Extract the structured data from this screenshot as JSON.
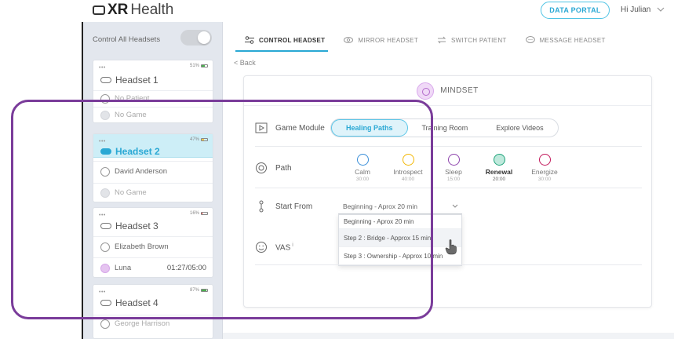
{
  "header": {
    "brand_bold": "XR",
    "brand_light": "Health",
    "portal_button": "DATA PORTAL",
    "greeting": "Hi Julian"
  },
  "sidebar": {
    "control_all_label": "Control All Headsets",
    "control_all_on": false,
    "headsets": [
      {
        "name": "Headset 1",
        "battery": "51%",
        "battery_level": 0.51,
        "battery_color": "#4caf50",
        "patient": "No Patient",
        "game": "No Game",
        "timer": "",
        "active": false
      },
      {
        "name": "Headset 2",
        "battery": "47%",
        "battery_level": 0.47,
        "battery_color": "#f2c94c",
        "patient": "David Anderson",
        "game": "No Game",
        "timer": "",
        "active": true
      },
      {
        "name": "Headset 3",
        "battery": "16%",
        "battery_level": 0.16,
        "battery_color": "#e53935",
        "patient": "Elizabeth Brown",
        "game": "Luna",
        "timer": "01:27/05:00",
        "active": false
      },
      {
        "name": "Headset 4",
        "battery": "87%",
        "battery_level": 0.87,
        "battery_color": "#4caf50",
        "patient": "George Harrison",
        "game": "",
        "timer": "",
        "active": false
      }
    ]
  },
  "tabs": [
    {
      "label": "CONTROL HEADSET",
      "icon": "sliders-icon",
      "active": true
    },
    {
      "label": "MIRROR HEADSET",
      "icon": "eye-icon",
      "active": false
    },
    {
      "label": "SWITCH PATIENT",
      "icon": "swap-arrows-icon",
      "active": false
    },
    {
      "label": "MESSAGE HEADSET",
      "icon": "chat-bubble-icon",
      "active": false
    }
  ],
  "back_label": "< Back",
  "panel": {
    "title": "MINDSET",
    "game_module": {
      "label": "Game Module",
      "options": [
        "Healing Paths",
        "Training Room",
        "Explore Videos"
      ],
      "selected": "Healing Paths"
    },
    "path": {
      "label": "Path",
      "options": [
        {
          "name": "Calm",
          "duration": "30:00",
          "color": "#3a8fd9",
          "fill": "transparent",
          "selected": false
        },
        {
          "name": "Introspect",
          "duration": "40:00",
          "color": "#f2b705",
          "fill": "transparent",
          "selected": false
        },
        {
          "name": "Sleep",
          "duration": "15:00",
          "color": "#8e44ad",
          "fill": "transparent",
          "selected": false
        },
        {
          "name": "Renewal",
          "duration": "20:00",
          "color": "#1fa37a",
          "fill": "#bfe9dc",
          "selected": true
        },
        {
          "name": "Energize",
          "duration": "30:00",
          "color": "#c2185b",
          "fill": "transparent",
          "selected": false
        }
      ]
    },
    "start_from": {
      "label": "Start From",
      "value": "Beginning - Aprox 20 min",
      "options": [
        "Beginning - Aprox 20 min",
        "Step 2 : Bridge - Approx 15 min",
        "Step 3 : Ownership - Approx 10 min"
      ],
      "highlighted": "Step 2 : Bridge - Approx 15 min"
    },
    "vas": {
      "label": "VAS",
      "info": "i"
    }
  },
  "colors": {
    "accent": "#2aa8d4",
    "annotation": "#7a3c9a",
    "sidebar_bg": "#e3e7ee"
  }
}
